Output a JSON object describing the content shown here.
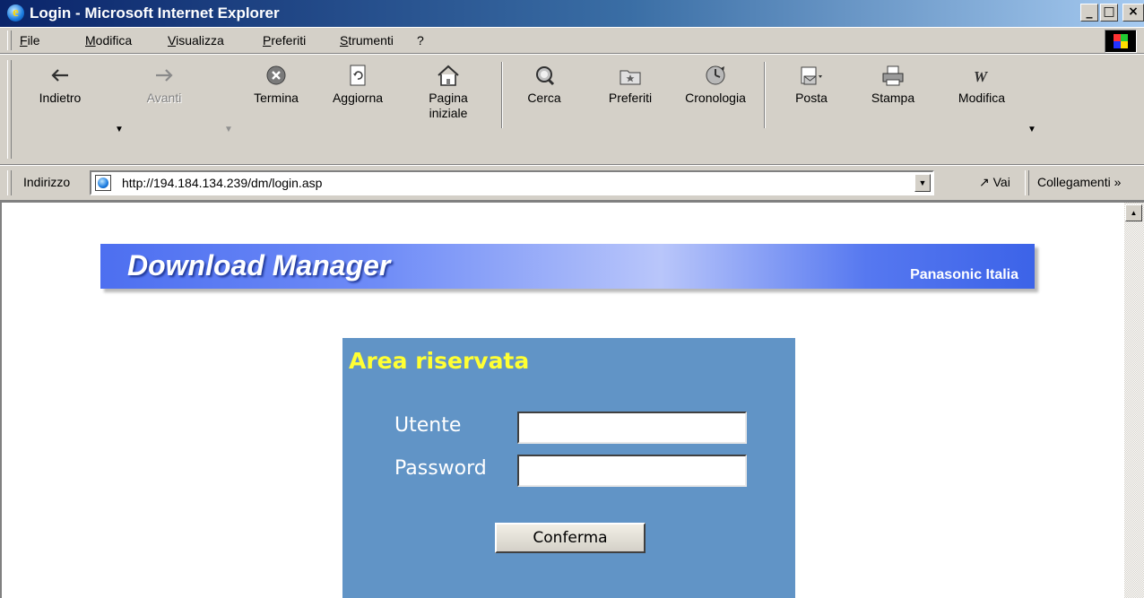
{
  "window": {
    "title": "Login - Microsoft Internet Explorer",
    "controls": {
      "minimize": "_",
      "maximize": "□",
      "close": "×"
    }
  },
  "menubar": {
    "items": [
      {
        "label": "File",
        "accel": "F"
      },
      {
        "label": "Modifica",
        "accel": "M"
      },
      {
        "label": "Visualizza",
        "accel": "V"
      },
      {
        "label": "Preferiti",
        "accel": "P"
      },
      {
        "label": "Strumenti",
        "accel": "S"
      },
      {
        "label": "?",
        "accel": "?"
      }
    ]
  },
  "toolbar": {
    "back": {
      "label": "Indietro",
      "icon": "back-arrow-icon"
    },
    "forward": {
      "label": "Avanti",
      "icon": "forward-arrow-icon",
      "enabled": false
    },
    "stop": {
      "label": "Termina",
      "icon": "stop-icon"
    },
    "refresh": {
      "label": "Aggiorna",
      "icon": "refresh-icon"
    },
    "home": {
      "label_line1": "Pagina",
      "label_line2": "iniziale",
      "icon": "home-icon"
    },
    "search": {
      "label": "Cerca",
      "icon": "search-icon"
    },
    "favorites": {
      "label": "Preferiti",
      "icon": "favorites-icon"
    },
    "history": {
      "label": "Cronologia",
      "icon": "history-icon"
    },
    "mail": {
      "label": "Posta",
      "icon": "mail-icon"
    },
    "print": {
      "label": "Stampa",
      "icon": "print-icon"
    },
    "edit": {
      "label": "Modifica",
      "icon": "edit-icon"
    }
  },
  "addressbar": {
    "label": "Indirizzo",
    "url": "http://194.184.134.239/dm/login.asp",
    "go_label": "Vai",
    "links_label": "Collegamenti"
  },
  "page": {
    "banner": {
      "title": "Download Manager",
      "subtitle": "Panasonic Italia"
    },
    "login": {
      "title": "Area riservata",
      "user_label": "Utente",
      "user_value": "",
      "password_label": "Password",
      "password_value": "",
      "submit_label": "Conferma"
    }
  },
  "colors": {
    "title_bar": "#0a246a",
    "banner": "#4d6ff0",
    "login_panel": "#6194c6",
    "login_title": "#ffff33"
  }
}
